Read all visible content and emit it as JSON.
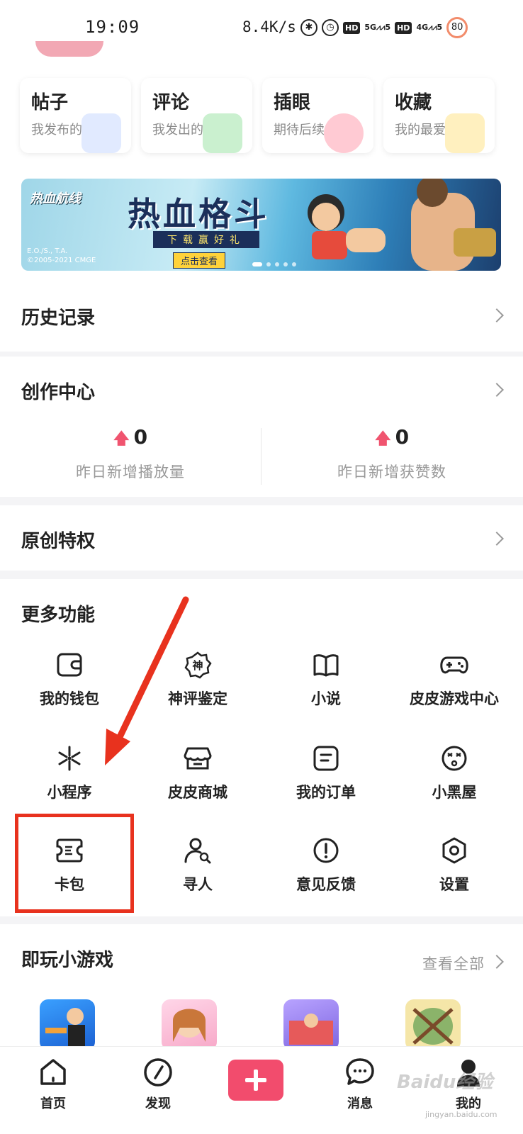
{
  "status_bar": {
    "time": "19:09",
    "net_speed": "8.4K/s",
    "network_1": "5G",
    "network_2": "4G",
    "hd_label": "HD",
    "battery": "80"
  },
  "quick_cards": [
    {
      "title": "帖子",
      "subtitle": "我发布的",
      "color": "#c9d8ff"
    },
    {
      "title": "评论",
      "subtitle": "我发出的",
      "color": "#9ee3a8"
    },
    {
      "title": "插眼",
      "subtitle": "期待后续",
      "color": "#ff9fae"
    },
    {
      "title": "收藏",
      "subtitle": "我的最爱",
      "color": "#ffe38a"
    }
  ],
  "banner": {
    "logo": "热血航线",
    "title": "热血格斗",
    "subtitle": "下载赢好礼",
    "button": "点击查看",
    "copyright_1": "E.O./S., T.A.",
    "copyright_2": "©2005-2021 CMGE"
  },
  "history": {
    "title": "历史记录"
  },
  "creation": {
    "title": "创作中心",
    "stats": [
      {
        "value": "0",
        "label": "昨日新增播放量"
      },
      {
        "value": "0",
        "label": "昨日新增获赞数"
      }
    ]
  },
  "original": {
    "title": "原创特权"
  },
  "more": {
    "title": "更多功能",
    "items": [
      {
        "label": "我的钱包",
        "icon": "wallet-icon"
      },
      {
        "label": "神评鉴定",
        "icon": "divine-badge-icon",
        "glyph": "神"
      },
      {
        "label": "小说",
        "icon": "book-icon"
      },
      {
        "label": "皮皮游戏中心",
        "icon": "gamepad-icon"
      },
      {
        "label": "小程序",
        "icon": "mini-program-icon"
      },
      {
        "label": "皮皮商城",
        "icon": "store-icon"
      },
      {
        "label": "我的订单",
        "icon": "order-icon"
      },
      {
        "label": "小黑屋",
        "icon": "dizzy-face-icon"
      },
      {
        "label": "卡包",
        "icon": "card-pack-icon"
      },
      {
        "label": "寻人",
        "icon": "find-person-icon"
      },
      {
        "label": "意见反馈",
        "icon": "feedback-icon"
      },
      {
        "label": "设置",
        "icon": "settings-icon"
      }
    ]
  },
  "games": {
    "title": "即玩小游戏",
    "see_all": "查看全部"
  },
  "tabbar": {
    "tabs": [
      {
        "label": "首页",
        "icon": "home-icon"
      },
      {
        "label": "发现",
        "icon": "compass-icon"
      },
      {
        "label": "消息",
        "icon": "message-icon"
      },
      {
        "label": "我的",
        "icon": "profile-icon"
      }
    ],
    "add_icon": "plus-icon"
  },
  "watermark": {
    "text": "Baidu经验",
    "sub": "jingyan.baidu.com"
  },
  "colors": {
    "accent": "#f24c6d",
    "annotation": "#e8321e"
  }
}
